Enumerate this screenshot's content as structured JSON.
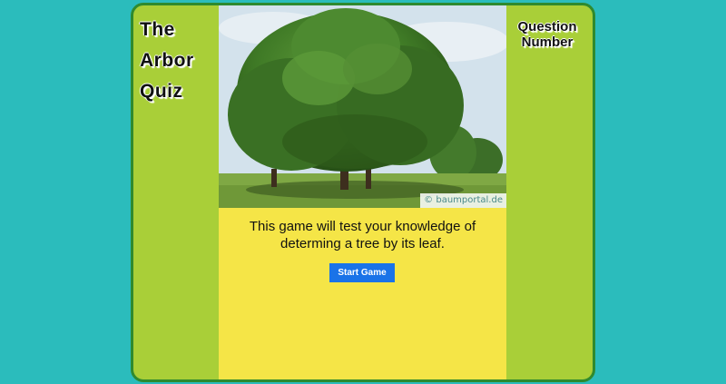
{
  "title_lines": [
    "The",
    "Arbor",
    "Quiz"
  ],
  "question_number_label": "Question Number",
  "image": {
    "watermark": "© baumportal.de",
    "subject": "tree-photo"
  },
  "intro_text": "This game will test your knowledge of determing a tree by its leaf.",
  "start_button_label": "Start Game",
  "colors": {
    "page_background": "#2bbcbc",
    "side_panels": "#a9cf38",
    "border": "#2f8a2f",
    "center_panel": "#f5e547",
    "button": "#1a73e8"
  }
}
